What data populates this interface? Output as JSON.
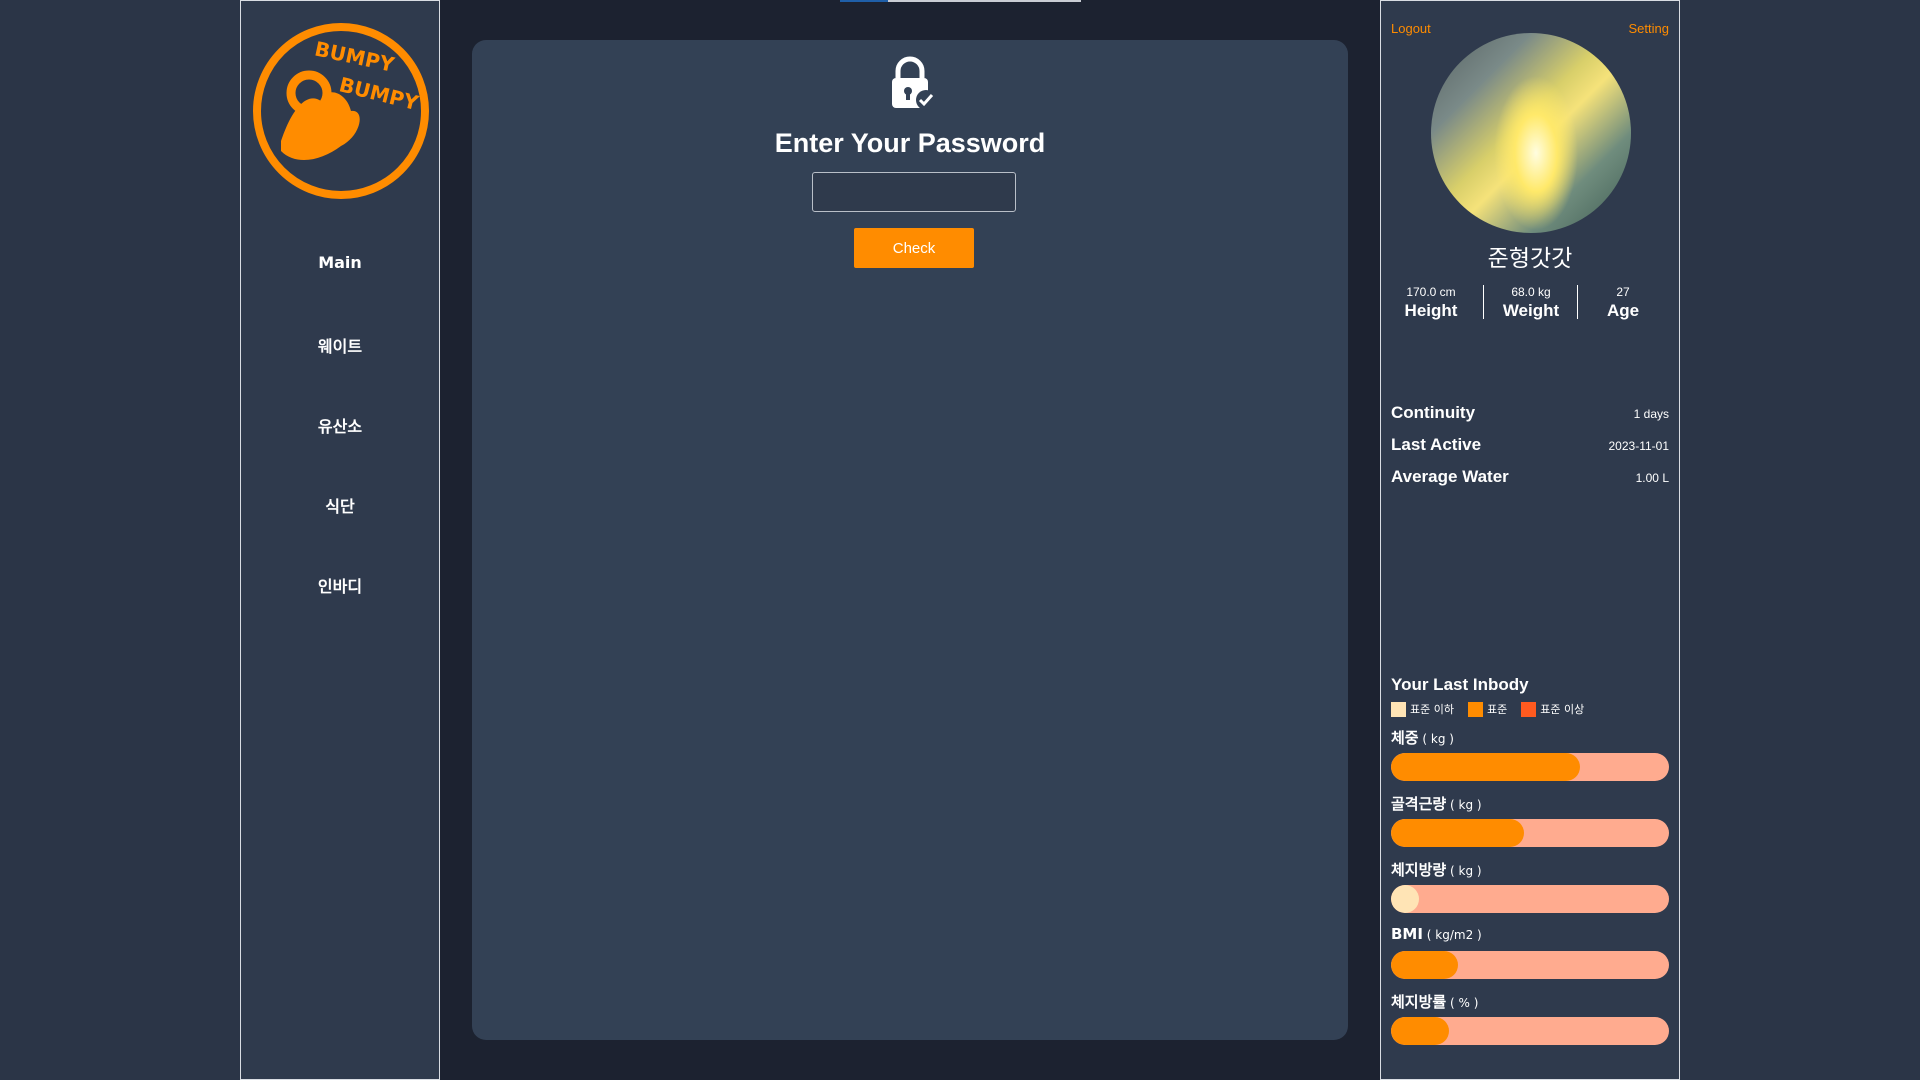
{
  "sidebar": {
    "logo_text": [
      "BUMPY",
      "BUMPY"
    ],
    "items": [
      {
        "label": "Main"
      },
      {
        "label": "웨이트"
      },
      {
        "label": "유산소"
      },
      {
        "label": "식단"
      },
      {
        "label": "인바디"
      }
    ]
  },
  "main": {
    "title": "Enter Your Password",
    "password_value": "",
    "button_label": "Check"
  },
  "profile": {
    "logout_label": "Logout",
    "setting_label": "Setting",
    "name": "준형갓갓",
    "stats": [
      {
        "value": "170.0 cm",
        "label": "Height"
      },
      {
        "value": "68.0 kg",
        "label": "Weight"
      },
      {
        "value": "27",
        "label": "Age"
      }
    ],
    "info": [
      {
        "label": "Continuity",
        "value": "1 days"
      },
      {
        "label": "Last Active",
        "value": "2023-11-01"
      },
      {
        "label": "Average Water",
        "value": "1.00 L"
      }
    ]
  },
  "inbody": {
    "title": "Your Last Inbody",
    "legend": [
      {
        "label": "표준 이하",
        "color": "#ffe4b5"
      },
      {
        "label": "표준",
        "color": "#ff8c00"
      },
      {
        "label": "표준 이상",
        "color": "#ff5a1f"
      }
    ],
    "metrics": [
      {
        "label": "체중",
        "unit": " ( kg )",
        "fill": 0.68,
        "level": "standard"
      },
      {
        "label": "골격근량",
        "unit": " ( kg )",
        "fill": 0.48,
        "level": "standard"
      },
      {
        "label": "체지방량",
        "unit": " ( kg )",
        "fill": 0.1,
        "level": "below"
      },
      {
        "label": "BMI",
        "unit": " ( kg/m2 )",
        "fill": 0.24,
        "level": "standard"
      },
      {
        "label": "체지방률",
        "unit": " ( % )",
        "fill": 0.21,
        "level": "standard"
      }
    ]
  },
  "colors": {
    "accent": "#ff8c00",
    "panel": "#334155",
    "background": "#1c2230",
    "bar_track": "#ffab8f"
  }
}
